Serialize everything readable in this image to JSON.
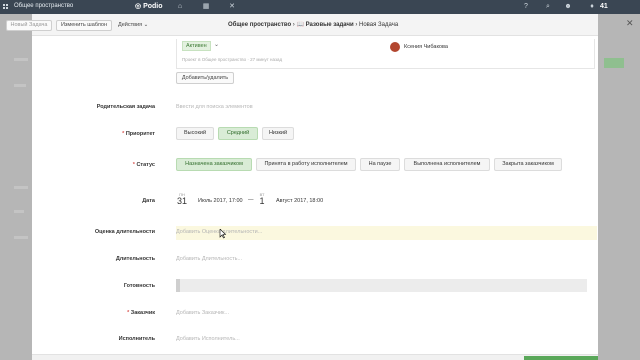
{
  "topbar": {
    "workspace": "Общее пространство",
    "logo": "Podio",
    "count": "41",
    "icons": [
      "apps-grid-icon",
      "home-icon",
      "calendar-icon",
      "tools-icon",
      "help-icon",
      "search-icon",
      "user-icon",
      "bell-icon"
    ]
  },
  "toolbar": {
    "new_task": "Новый Задача",
    "change_template": "Изменить шаблон",
    "actions": "Действия"
  },
  "breadcrumb": {
    "workspace": "Общее пространство",
    "app": "Разовые задачи",
    "item": "Новая Задача"
  },
  "header_card": {
    "status_badge": "Активен",
    "meta": "Проект в Общее пространство · 27 минут назад",
    "user_name": "Ксения Чибакова",
    "add_remove": "Добавить/удалить"
  },
  "fields": {
    "parent_task": {
      "label": "Родительская задача",
      "placeholder": "Ввести для поиска элементов"
    },
    "priority": {
      "label": "Приоритет",
      "options": [
        "Высокий",
        "Средний",
        "Низкий"
      ],
      "selected": "Средний"
    },
    "status": {
      "label": "Статус",
      "options": [
        "Назначена заказчиком",
        "Принята в работу исполнителем",
        "На паузе",
        "Выполнена исполнителем",
        "Закрыта заказчиком"
      ],
      "selected": "Назначена заказчиком"
    },
    "date": {
      "label": "Дата",
      "start_weekday": "ПН",
      "start_day": "31",
      "start_text": "Июль 2017, 17:00",
      "dash": "—",
      "end_weekday": "ВТ",
      "end_day": "1",
      "end_text": "Август 2017, 18:00"
    },
    "estimate": {
      "label": "Оценка длительности",
      "placeholder": "Добавить Оценка длительности..."
    },
    "duration": {
      "label": "Длительность",
      "placeholder": "Добавить Длительность..."
    },
    "readiness": {
      "label": "Готовность",
      "progress": 0
    },
    "customer": {
      "label": "Заказчик",
      "placeholder": "Добавить Заказчик..."
    },
    "executor": {
      "label": "Исполнитель",
      "placeholder": "Добавить Исполнитель..."
    }
  },
  "required_mark": "*",
  "colors": {
    "topbar": "#3a4653",
    "accent_green": "#5aa85a",
    "selected_bg": "#d9ecd6"
  }
}
